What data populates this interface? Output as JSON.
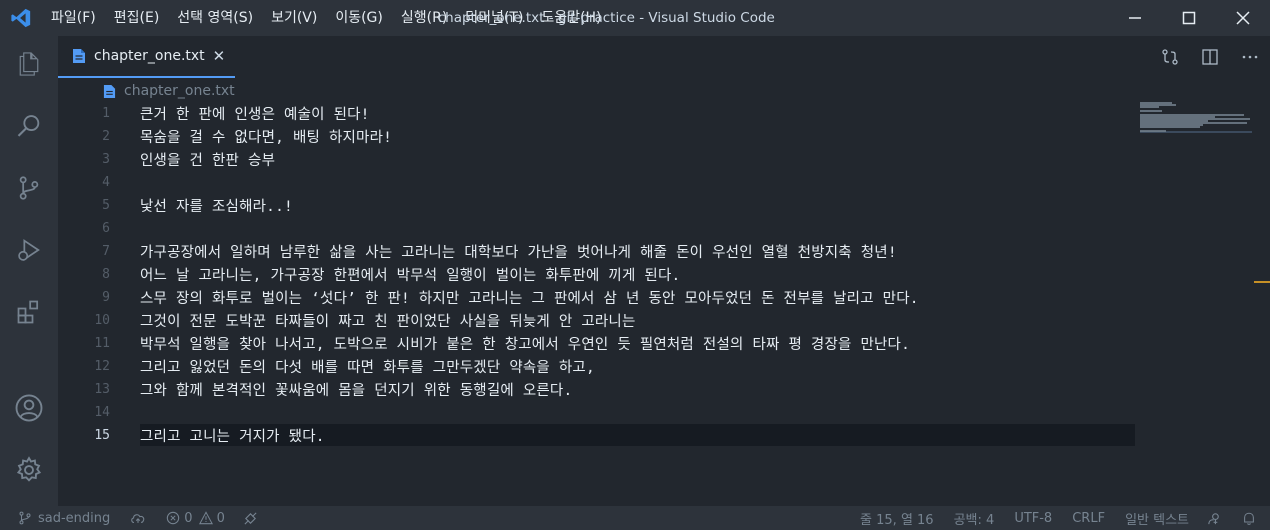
{
  "menu": [
    "파일(F)",
    "편집(E)",
    "선택 영역(S)",
    "보기(V)",
    "이동(G)",
    "실행(R)",
    "터미널(T)",
    "도움말(H)"
  ],
  "window_title": "chapter_one.txt - git-practice - Visual Studio Code",
  "tab": {
    "label": "chapter_one.txt"
  },
  "breadcrumb": {
    "file": "chapter_one.txt"
  },
  "lines": [
    {
      "num": "1",
      "text": "큰거 한 판에 인생은 예술이 된다!"
    },
    {
      "num": "2",
      "text": "목숨을 걸 수 없다면, 배팅 하지마라!"
    },
    {
      "num": "3",
      "text": "인생을 건 한판 승부"
    },
    {
      "num": "4",
      "text": ""
    },
    {
      "num": "5",
      "text": "낯선 자를 조심해라..!"
    },
    {
      "num": "6",
      "text": ""
    },
    {
      "num": "7",
      "text": "가구공장에서 일하며 남루한 삶을 사는 고라니는 대학보다 가난을 벗어나게 해줄 돈이 우선인 열혈 천방지축 청년!"
    },
    {
      "num": "8",
      "text": "어느 날 고라니는, 가구공장 한편에서 박무석 일행이 벌이는 화투판에 끼게 된다."
    },
    {
      "num": "9",
      "text": "스무 장의 화투로 벌이는 ‘섯다’ 한 판! 하지만 고라니는 그 판에서 삼 년 동안 모아두었던 돈 전부를 날리고 만다."
    },
    {
      "num": "10",
      "text": "그것이 전문 도박꾼 타짜들이 짜고 친 판이었단 사실을 뒤늦게 안 고라니는"
    },
    {
      "num": "11",
      "text": "박무석 일행을 찾아 나서고, 도박으로 시비가 붙은 한 창고에서 우연인 듯 필연처럼 전설의 타짜 평 경장을 만난다."
    },
    {
      "num": "12",
      "text": "그리고 잃었던 돈의 다섯 배를 따면 화투를 그만두겠단 약속을 하고,"
    },
    {
      "num": "13",
      "text": "그와 함께 본격적인 꽃싸움에 몸을 던지기 위한 동행길에 오른다."
    },
    {
      "num": "14",
      "text": ""
    },
    {
      "num": "15",
      "text": "그리고 고니는 거지가 됐다."
    }
  ],
  "status": {
    "branch": "sad-ending",
    "errors": "0",
    "warnings": "0",
    "position": "줄 15, 열 16",
    "spaces": "공백: 4",
    "encoding": "UTF-8",
    "eol": "CRLF",
    "language": "일반 텍스트"
  },
  "colors": {
    "accent": "#539bf5",
    "background": "#22272e",
    "chrome": "#2d333b"
  }
}
